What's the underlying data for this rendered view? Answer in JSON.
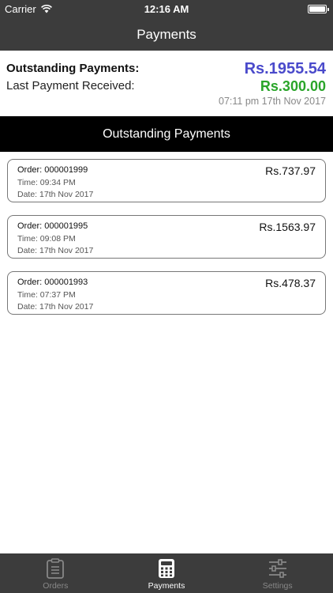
{
  "status_bar": {
    "carrier": "Carrier",
    "time": "12:16 AM",
    "battery_level": 1.0
  },
  "nav": {
    "title": "Payments"
  },
  "summary": {
    "outstanding_label": "Outstanding Payments:",
    "outstanding_amount": "Rs.1955.54",
    "last_payment_label": "Last Payment Received:",
    "last_payment_amount": "Rs.300.00",
    "last_payment_datetime": "07:11 pm 17th Nov 2017",
    "colors": {
      "outstanding": "#4a4acb",
      "last_payment": "#2aa52a"
    }
  },
  "section": {
    "title": "Outstanding Payments"
  },
  "orders": [
    {
      "order": "Order: 000001999",
      "time": "Time: 09:34 PM",
      "date": "Date: 17th Nov 2017",
      "amount": "Rs.737.97"
    },
    {
      "order": "Order: 000001995",
      "time": "Time: 09:08 PM",
      "date": "Date: 17th Nov 2017",
      "amount": "Rs.1563.97"
    },
    {
      "order": "Order: 000001993",
      "time": "Time: 07:37 PM",
      "date": "Date: 17th Nov 2017",
      "amount": "Rs.478.37"
    }
  ],
  "tabs": [
    {
      "label": "Orders",
      "icon": "clipboard-icon",
      "active": false
    },
    {
      "label": "Payments",
      "icon": "calculator-icon",
      "active": true
    },
    {
      "label": "Settings",
      "icon": "sliders-icon",
      "active": false
    }
  ]
}
